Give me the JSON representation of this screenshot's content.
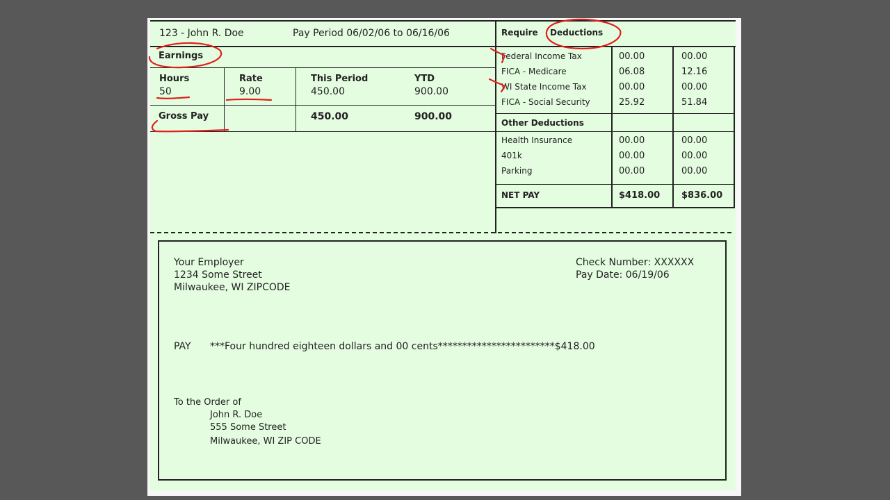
{
  "stub": {
    "employee": "123 - John R. Doe",
    "pay_period": "Pay Period 06/02/06 to 06/16/06",
    "earnings_label": "Earnings",
    "headers": {
      "hours": "Hours",
      "rate": "Rate",
      "this_period": "This Period",
      "ytd": "YTD"
    },
    "hours": "50",
    "rate": "9.00",
    "this_period": "450.00",
    "ytd": "900.00",
    "gross_pay_label": "Gross Pay",
    "gross_this_period": "450.00",
    "gross_ytd": "900.00"
  },
  "deductions": {
    "required_label_a": "Require",
    "required_label_b": "Deductions",
    "required": [
      {
        "name": "Federal Income Tax",
        "current": "00.00",
        "ytd": "00.00"
      },
      {
        "name": "FICA - Medicare",
        "current": "06.08",
        "ytd": "12.16"
      },
      {
        "name": "WI State Income Tax",
        "current": "00.00",
        "ytd": "00.00"
      },
      {
        "name": "FICA - Social Security",
        "current": "25.92",
        "ytd": "51.84"
      }
    ],
    "other_label": "Other Deductions",
    "other": [
      {
        "name": "Health Insurance",
        "current": "00.00",
        "ytd": "00.00"
      },
      {
        "name": "401k",
        "current": "00.00",
        "ytd": "00.00"
      },
      {
        "name": "Parking",
        "current": "00.00",
        "ytd": "00.00"
      }
    ],
    "net_pay_label": "NET PAY",
    "net_pay_current": "$418.00",
    "net_pay_ytd": "$836.00"
  },
  "check": {
    "employer_name": "Your Employer",
    "employer_street": "1234 Some Street",
    "employer_city": "Milwaukee, WI ZIPCODE",
    "check_number": "Check Number: XXXXXX",
    "pay_date": "Pay Date: 06/19/06",
    "pay_label": "PAY",
    "pay_words": "***Four hundred eighteen dollars and 00 cents************************$418.00",
    "order_label": "To the Order of",
    "payee_name": "John R. Doe",
    "payee_street": "555 Some Street",
    "payee_city": "Milwaukee, WI ZIP CODE"
  },
  "annotation_color": "#e0201c"
}
